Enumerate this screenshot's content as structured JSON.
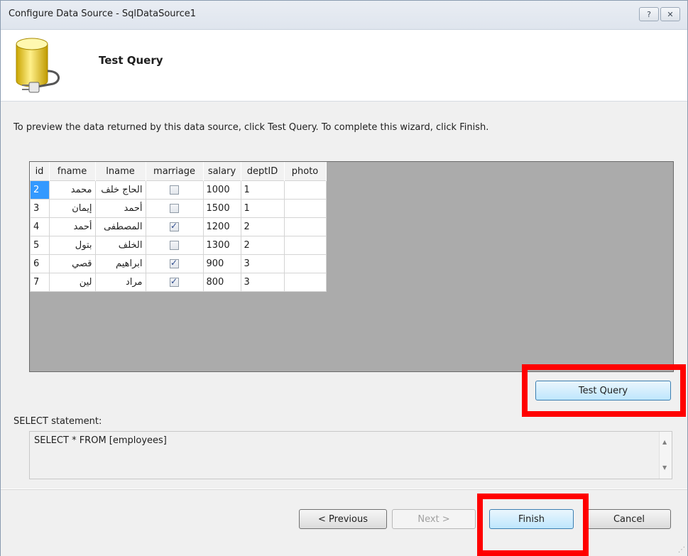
{
  "window": {
    "title": "Configure Data Source - SqlDataSource1",
    "help_label": "?",
    "close_label": "✕"
  },
  "header": {
    "title": "Test Query"
  },
  "instructions": "To preview the data returned by this data source, click Test Query. To complete this wizard, click Finish.",
  "grid": {
    "columns": [
      "id",
      "fname",
      "lname",
      "marriage",
      "salary",
      "deptID",
      "photo"
    ],
    "rows": [
      {
        "id": "2",
        "fname": "محمد",
        "lname": "الحاج خلف",
        "marriage": false,
        "salary": "1000",
        "deptID": "1",
        "photo": ""
      },
      {
        "id": "3",
        "fname": "إيمان",
        "lname": "أحمد",
        "marriage": false,
        "salary": "1500",
        "deptID": "1",
        "photo": ""
      },
      {
        "id": "4",
        "fname": "أحمد",
        "lname": "المصطفى",
        "marriage": true,
        "salary": "1200",
        "deptID": "2",
        "photo": ""
      },
      {
        "id": "5",
        "fname": "بتول",
        "lname": "الخلف",
        "marriage": false,
        "salary": "1300",
        "deptID": "2",
        "photo": ""
      },
      {
        "id": "6",
        "fname": "قصي",
        "lname": "ابراهيم",
        "marriage": true,
        "salary": "900",
        "deptID": "3",
        "photo": ""
      },
      {
        "id": "7",
        "fname": "لين",
        "lname": "مراد",
        "marriage": true,
        "salary": "800",
        "deptID": "3",
        "photo": ""
      }
    ]
  },
  "buttons": {
    "test_query": "Test Query",
    "previous": "< Previous",
    "next": "Next >",
    "finish": "Finish",
    "cancel": "Cancel"
  },
  "select_statement": {
    "label": "SELECT statement:",
    "value": "SELECT * FROM [employees]"
  },
  "colors": {
    "highlight": "#ff0000",
    "selection": "#3399ff",
    "grid_background": "#ababab"
  },
  "icons": [
    "database-plug-icon",
    "help-icon",
    "close-icon",
    "scroll-up-icon",
    "scroll-down-icon"
  ]
}
